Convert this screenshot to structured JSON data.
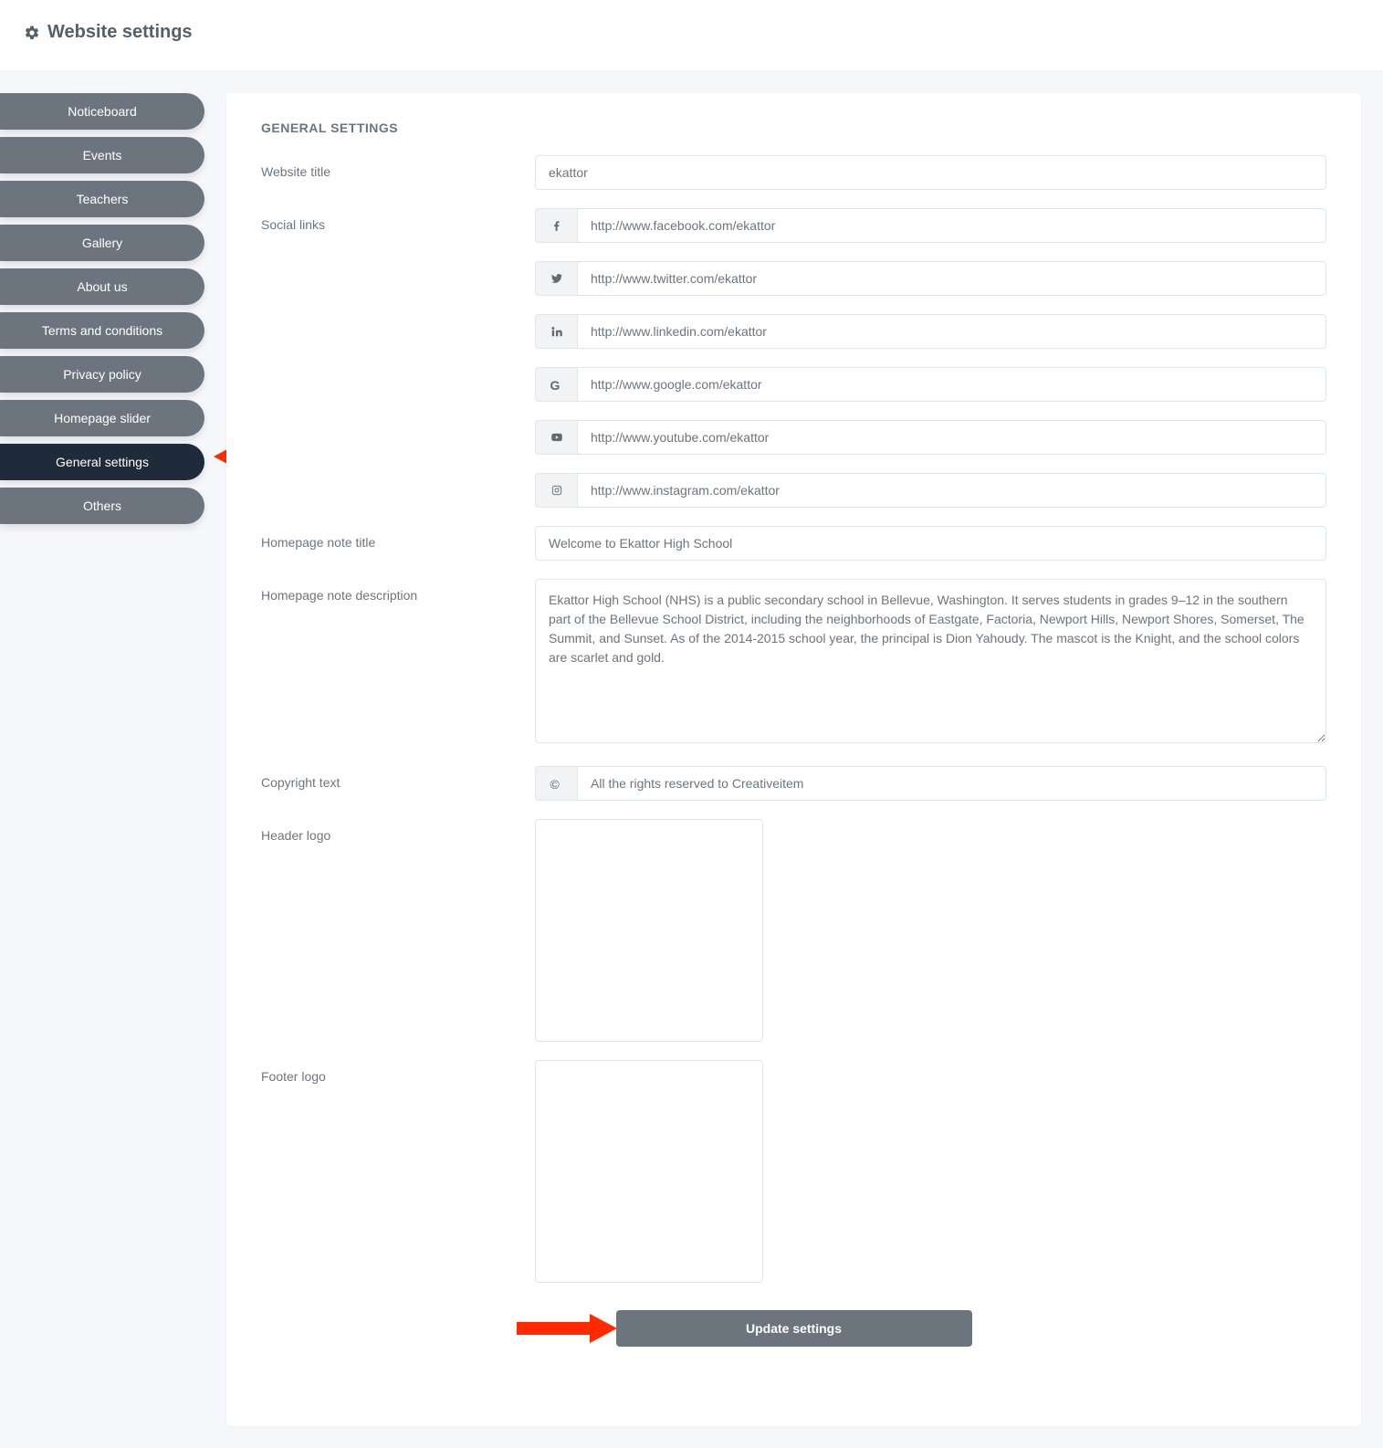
{
  "header": {
    "title": "Website settings"
  },
  "sidebar": {
    "items": [
      {
        "label": "Noticeboard",
        "active": false
      },
      {
        "label": "Events",
        "active": false
      },
      {
        "label": "Teachers",
        "active": false
      },
      {
        "label": "Gallery",
        "active": false
      },
      {
        "label": "About us",
        "active": false
      },
      {
        "label": "Terms and conditions",
        "active": false
      },
      {
        "label": "Privacy policy",
        "active": false
      },
      {
        "label": "Homepage slider",
        "active": false
      },
      {
        "label": "General settings",
        "active": true
      },
      {
        "label": "Others",
        "active": false
      }
    ]
  },
  "panel": {
    "heading": "GENERAL SETTINGS",
    "labels": {
      "website_title": "Website title",
      "social_links": "Social links",
      "homepage_note_title": "Homepage note title",
      "homepage_note_desc": "Homepage note description",
      "copyright": "Copyright text",
      "header_logo": "Header logo",
      "footer_logo": "Footer logo"
    },
    "values": {
      "website_title": "ekattor",
      "facebook": "http://www.facebook.com/ekattor",
      "twitter": "http://www.twitter.com/ekattor",
      "linkedin": "http://www.linkedin.com/ekattor",
      "google": "http://www.google.com/ekattor",
      "youtube": "http://www.youtube.com/ekattor",
      "instagram": "http://www.instagram.com/ekattor",
      "homepage_note_title": "Welcome to Ekattor High School",
      "homepage_note_desc": "Ekattor High School (NHS) is a public secondary school in Bellevue, Washington. It serves students in grades 9–12 in the southern part of the Bellevue School District, including the neighborhoods of Eastgate, Factoria, Newport Hills, Newport Shores, Somerset, The Summit, and Sunset. As of the 2014-2015 school year, the principal is Dion Yahoudy. The mascot is the Knight, and the school colors are scarlet and gold.",
      "copyright": "All the rights reserved to Creativeitem"
    },
    "submit_label": "Update settings"
  }
}
